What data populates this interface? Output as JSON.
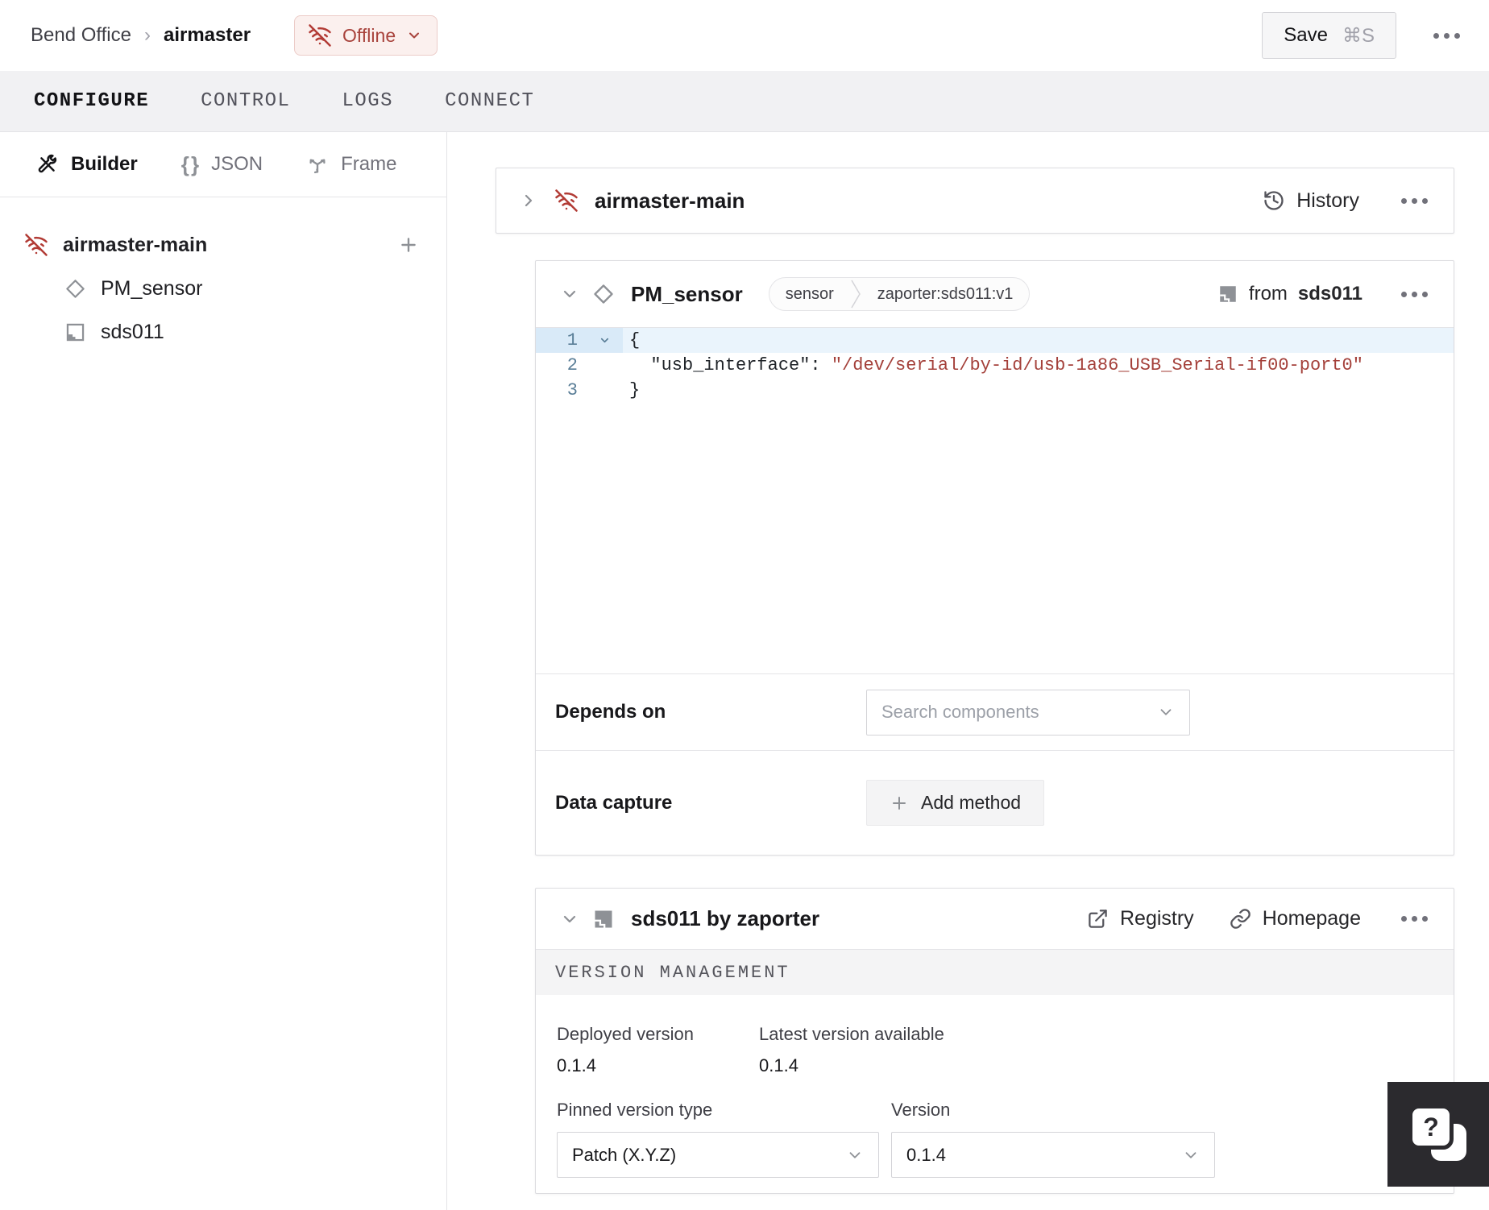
{
  "colors": {
    "status_offline_text": "#a8433c",
    "status_offline_bg": "#fbf0ee",
    "status_offline_border": "#ecccc8",
    "wifi_off_icon": "#b23b35",
    "code_string": "#a4403a",
    "code_line_number": "#5a7e97",
    "active_line_bg": "#eaf4fc",
    "tabbar_bg": "#f1f1f3"
  },
  "topbar": {
    "breadcrumb": {
      "location": "Bend Office",
      "separator": "›",
      "machine": "airmaster"
    },
    "status": {
      "label": "Offline"
    },
    "save_label": "Save",
    "save_shortcut": "⌘S"
  },
  "tabs": [
    {
      "label": "CONFIGURE"
    },
    {
      "label": "CONTROL"
    },
    {
      "label": "LOGS"
    },
    {
      "label": "CONNECT"
    }
  ],
  "sidebar": {
    "modes": [
      {
        "label": "Builder"
      },
      {
        "label": "JSON"
      },
      {
        "label": "Frame"
      }
    ],
    "tree": {
      "root": "airmaster-main",
      "children": [
        "PM_sensor",
        "sds011"
      ]
    }
  },
  "part": {
    "title": "airmaster-main",
    "history_label": "History"
  },
  "component": {
    "title": "PM_sensor",
    "type_badge": "sensor",
    "model_badge": "zaporter:sds011:v1",
    "from_label": "from",
    "from_module": "sds011",
    "code": {
      "line1_num": "1",
      "line1": "{",
      "line2_num": "2",
      "line2_key": "  \"usb_interface\": ",
      "line2_value": "\"/dev/serial/by-id/usb-1a86_USB_Serial-if00-port0\"",
      "line3_num": "3",
      "line3": "}"
    },
    "depends": {
      "label": "Depends on",
      "placeholder": "Search components"
    },
    "capture": {
      "label": "Data capture",
      "button_label": "Add method"
    }
  },
  "module": {
    "title": "sds011 by zaporter",
    "registry_label": "Registry",
    "homepage_label": "Homepage",
    "section_title": "VERSION MANAGEMENT",
    "deployed_label": "Deployed version",
    "deployed_value": "0.1.4",
    "latest_label": "Latest version available",
    "latest_value": "0.1.4",
    "pinned_label": "Pinned version type",
    "pinned_value": "Patch (X.Y.Z)",
    "version_label": "Version",
    "version_value": "0.1.4"
  },
  "help": {
    "glyph": "?"
  }
}
